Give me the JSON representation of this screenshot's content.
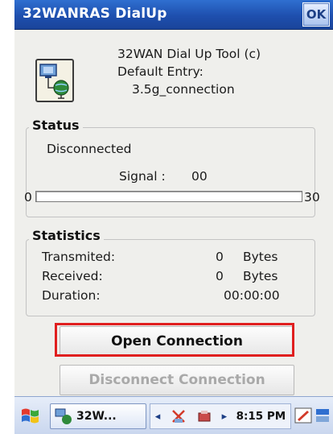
{
  "window": {
    "title": "32WANRAS DialUp",
    "ok_label": "OK"
  },
  "app_info": {
    "line1": "32WAN Dial Up Tool (c)",
    "line2": "Default Entry:",
    "line3": "3.5g_connection"
  },
  "status": {
    "group_label": "Status",
    "state": "Disconnected",
    "signal_label": "Signal :",
    "signal_value": "00",
    "range_min": "0",
    "range_max": "30",
    "signal_fraction": 0.0
  },
  "statistics": {
    "group_label": "Statistics",
    "rows": [
      {
        "label": "Transmited:",
        "value": "0",
        "unit": "Bytes"
      },
      {
        "label": "Received:",
        "value": "0",
        "unit": "Bytes"
      },
      {
        "label": "Duration:",
        "value": "00:00:00",
        "unit": ""
      }
    ]
  },
  "buttons": {
    "open": "Open Connection",
    "disconnect": "Disconnect Connection"
  },
  "taskbar": {
    "task_label": "32W...",
    "time": "8:15 PM"
  },
  "colors": {
    "title_bar": "#1e4fae",
    "highlight": "#e01f1f",
    "progress": "#2a5bd0"
  },
  "icons": [
    "network-connection-icon",
    "windows-start-icon",
    "task-app-icon",
    "tray-connection-icon",
    "tray-network-icon",
    "pen-input-icon",
    "keyboard-icon"
  ]
}
